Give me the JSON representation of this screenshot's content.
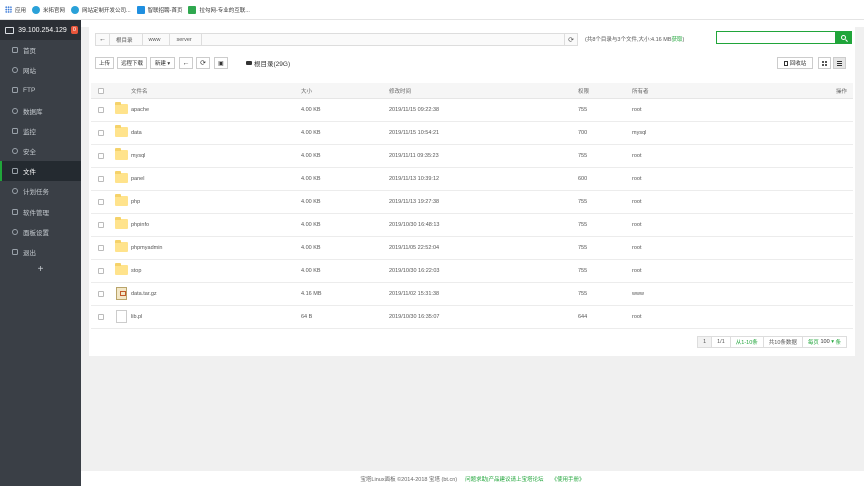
{
  "bookmarks": [
    {
      "label": "应用",
      "icon": "apps-grid-icon"
    },
    {
      "label": "米拓官网",
      "icon": "site-favicon-icon"
    },
    {
      "label": "网站定制开发公司...",
      "icon": "site-favicon-icon"
    },
    {
      "label": "智联招聘-首页",
      "icon": "site-favicon-icon"
    },
    {
      "label": "拉勾网-专业的互联...",
      "icon": "site-favicon-icon"
    }
  ],
  "sidebar": {
    "server_ip": "39.100.254.129",
    "badge": "0",
    "items": [
      {
        "label": "首页",
        "icon": "home-icon",
        "active": false
      },
      {
        "label": "网站",
        "icon": "globe-icon",
        "active": false
      },
      {
        "label": "FTP",
        "icon": "ftp-icon",
        "active": false
      },
      {
        "label": "数据库",
        "icon": "database-icon",
        "active": false
      },
      {
        "label": "监控",
        "icon": "monitor-icon",
        "active": false
      },
      {
        "label": "安全",
        "icon": "shield-icon",
        "active": false
      },
      {
        "label": "文件",
        "icon": "folder-icon",
        "active": true
      },
      {
        "label": "计划任务",
        "icon": "clock-icon",
        "active": false
      },
      {
        "label": "软件管理",
        "icon": "apps-icon",
        "active": false
      },
      {
        "label": "面板设置",
        "icon": "gear-icon",
        "active": false
      },
      {
        "label": "退出",
        "icon": "logout-icon",
        "active": false
      }
    ],
    "add_label": "+"
  },
  "path": {
    "back": "←",
    "crumbs": [
      "根目录",
      "www",
      "server"
    ],
    "refresh": "⟳"
  },
  "dir_info": {
    "text": "(共8个目录与3个文件,大小:4.16 MB",
    "link": "获取",
    "close": ")"
  },
  "search": {
    "placeholder": ""
  },
  "toolbar": {
    "upload": "上传",
    "remote_download": "远程下载",
    "new": "新建 ▾",
    "back": "←",
    "refresh": "⟳",
    "terminal": "▣",
    "disk": "根目录(29G)",
    "recycle": "回收站"
  },
  "table": {
    "headers": {
      "name": "文件名",
      "size": "大小",
      "time": "修改时间",
      "perm": "权限",
      "owner": "所有者",
      "action": "操作"
    },
    "rows": [
      {
        "name": "apache",
        "type": "folder",
        "size": "4.00 KB",
        "time": "2019/11/15 09:22:38",
        "perm": "755",
        "owner": "root"
      },
      {
        "name": "data",
        "type": "folder",
        "size": "4.00 KB",
        "time": "2019/11/15 10:54:21",
        "perm": "700",
        "owner": "mysql"
      },
      {
        "name": "mysql",
        "type": "folder",
        "size": "4.00 KB",
        "time": "2019/11/11 09:35:23",
        "perm": "755",
        "owner": "root"
      },
      {
        "name": "panel",
        "type": "folder",
        "size": "4.00 KB",
        "time": "2019/11/13 10:39:12",
        "perm": "600",
        "owner": "root"
      },
      {
        "name": "php",
        "type": "folder",
        "size": "4.00 KB",
        "time": "2019/11/13 19:27:38",
        "perm": "755",
        "owner": "root"
      },
      {
        "name": "phpinfo",
        "type": "folder",
        "size": "4.00 KB",
        "time": "2019/10/30 16:48:13",
        "perm": "755",
        "owner": "root"
      },
      {
        "name": "phpmyadmin",
        "type": "folder",
        "size": "4.00 KB",
        "time": "2019/11/05 22:52:04",
        "perm": "755",
        "owner": "root"
      },
      {
        "name": "stop",
        "type": "folder",
        "size": "4.00 KB",
        "time": "2019/10/30 16:22:03",
        "perm": "755",
        "owner": "root"
      },
      {
        "name": "data.tar.gz",
        "type": "archive",
        "size": "4.16 MB",
        "time": "2019/11/02 15:31:38",
        "perm": "755",
        "owner": "www"
      },
      {
        "name": "lib.pl",
        "type": "file",
        "size": "64 B",
        "time": "2019/10/30 16:35:07",
        "perm": "644",
        "owner": "root"
      }
    ]
  },
  "pagination": {
    "current": "1",
    "pages": "1/1",
    "range": "从1-10条",
    "total": "共10条数据",
    "per_page_label": "每页",
    "per_page": "100",
    "per_page_suffix": "条"
  },
  "footer": {
    "copyright": "宝塔Linux面板 ©2014-2018 宝塔 (bt.cn)",
    "link1": "问题求助|产品建议请上宝塔论坛",
    "link2": "《使用手册》"
  },
  "colors": {
    "accent": "#20a53a",
    "sidebar": "#3a3f46",
    "folder": "#ffe38c"
  }
}
